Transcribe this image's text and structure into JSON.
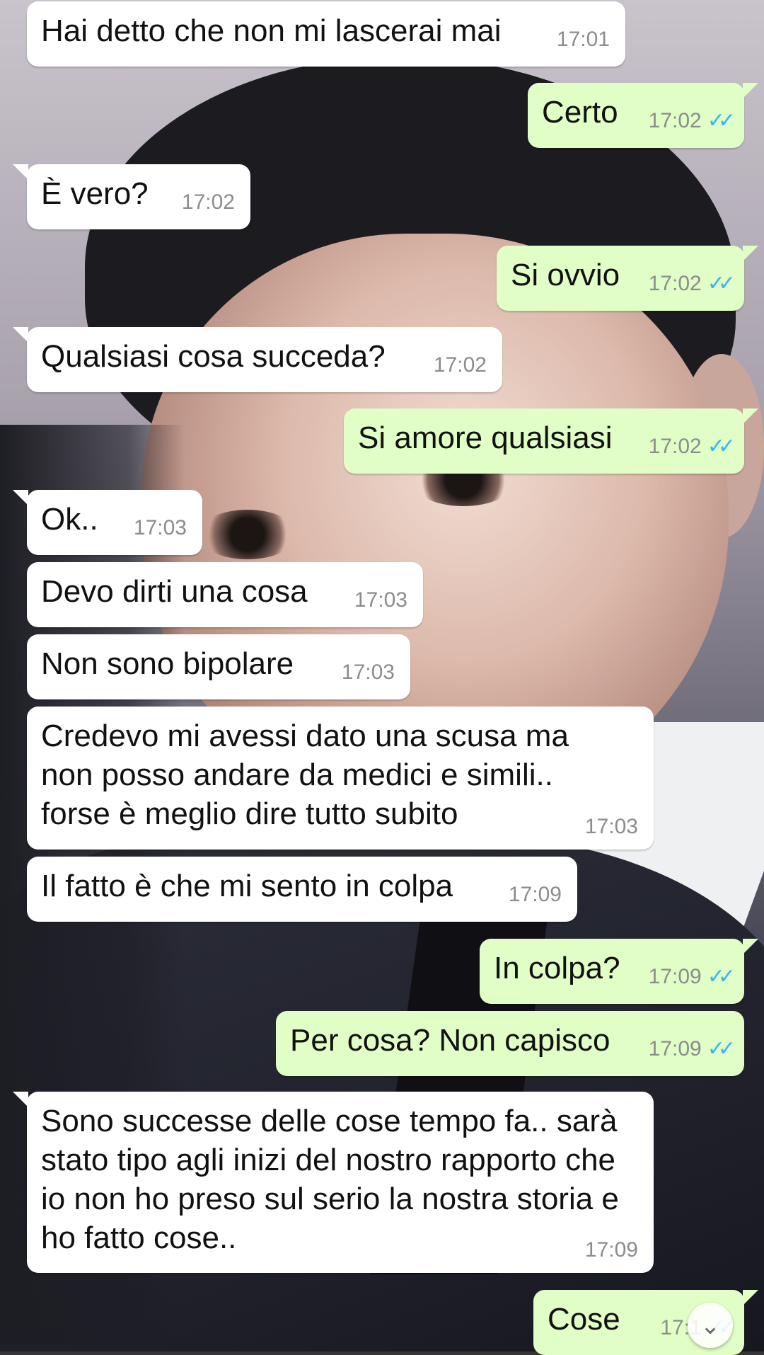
{
  "messages": [
    {
      "direction": "in",
      "text": "Hai detto che non mi lascerai mai",
      "time": "17:01"
    },
    {
      "direction": "out",
      "text": "Certo",
      "time": "17:02",
      "status": "read"
    },
    {
      "direction": "in",
      "text": "È vero?",
      "time": "17:02"
    },
    {
      "direction": "out",
      "text": "Si ovvio",
      "time": "17:02",
      "status": "read"
    },
    {
      "direction": "in",
      "text": "Qualsiasi cosa succeda?",
      "time": "17:02"
    },
    {
      "direction": "out",
      "text": "Si amore qualsiasi",
      "time": "17:02",
      "status": "read"
    },
    {
      "direction": "in",
      "text": "Ok..",
      "time": "17:03"
    },
    {
      "direction": "in",
      "text": "Devo dirti una cosa",
      "time": "17:03"
    },
    {
      "direction": "in",
      "text": "Non sono bipolare",
      "time": "17:03"
    },
    {
      "direction": "in",
      "text": "Credevo mi avessi dato una scusa ma non posso andare da medici e simili.. forse è meglio dire tutto subito",
      "time": "17:03"
    },
    {
      "direction": "in",
      "text": "Il fatto è che mi sento in colpa",
      "time": "17:09"
    },
    {
      "direction": "out",
      "text": "In colpa?",
      "time": "17:09",
      "status": "read"
    },
    {
      "direction": "out",
      "text": "Per cosa? Non capisco",
      "time": "17:09",
      "status": "read"
    },
    {
      "direction": "in",
      "text": "Sono successe delle cose tempo fa.. sarà stato tipo agli inizi del nostro rapporto che io non ho preso sul serio la nostra storia e ho fatto cose..",
      "time": "17:09"
    },
    {
      "direction": "out",
      "text": "Cose",
      "time": "17:1",
      "status": "read"
    }
  ],
  "icons": {
    "read_receipt": "double-check-icon",
    "scroll_down": "chevron-double-down-icon"
  },
  "colors": {
    "incoming_bubble": "#ffffff",
    "outgoing_bubble": "#e1fec6",
    "timestamp": "#8c8c8c",
    "read_check": "#34b7f1"
  }
}
